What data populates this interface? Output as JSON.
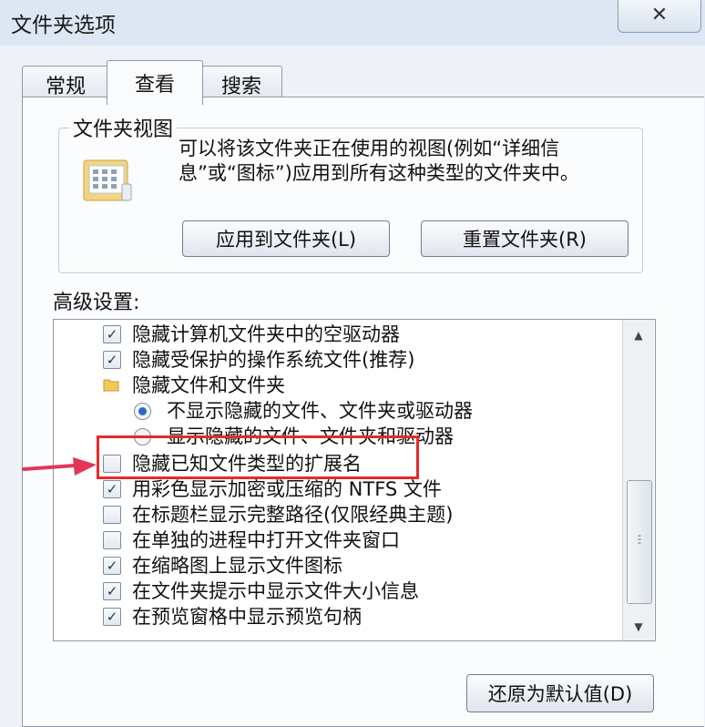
{
  "window": {
    "title": "文件夹选项",
    "close_label": "✕"
  },
  "tabs": [
    {
      "label": "常规",
      "active": false
    },
    {
      "label": "查看",
      "active": true
    },
    {
      "label": "搜索",
      "active": false
    }
  ],
  "folder_views": {
    "group_title": "文件夹视图",
    "description": "可以将该文件夹正在使用的视图(例如“详细信息”或“图标”)应用到所有这种类型的文件夹中。",
    "apply_button": "应用到文件夹(L)",
    "reset_button": "重置文件夹(R)"
  },
  "advanced": {
    "label": "高级设置:",
    "items": [
      {
        "type": "checkbox",
        "checked": true,
        "label": "隐藏计算机文件夹中的空驱动器"
      },
      {
        "type": "checkbox",
        "checked": true,
        "label": "隐藏受保护的操作系统文件(推荐)"
      },
      {
        "type": "folder",
        "label": "隐藏文件和文件夹"
      },
      {
        "type": "radio",
        "checked": true,
        "label": "不显示隐藏的文件、文件夹或驱动器"
      },
      {
        "type": "radio",
        "checked": false,
        "label": "显示隐藏的文件、文件夹和驱动器"
      },
      {
        "type": "checkbox",
        "checked": false,
        "label": "隐藏已知文件类型的扩展名",
        "highlighted": true
      },
      {
        "type": "checkbox",
        "checked": true,
        "label": "用彩色显示加密或压缩的 NTFS 文件"
      },
      {
        "type": "checkbox",
        "checked": false,
        "label": "在标题栏显示完整路径(仅限经典主题)"
      },
      {
        "type": "checkbox",
        "checked": false,
        "label": "在单独的进程中打开文件夹窗口"
      },
      {
        "type": "checkbox",
        "checked": true,
        "label": "在缩略图上显示文件图标"
      },
      {
        "type": "checkbox",
        "checked": true,
        "label": "在文件夹提示中显示文件大小信息"
      },
      {
        "type": "checkbox",
        "checked": true,
        "label": "在预览窗格中显示预览句柄"
      }
    ],
    "restore_button": "还原为默认值(D)"
  },
  "colors": {
    "highlight": "#e8292b",
    "arrow": "#e0365a"
  }
}
